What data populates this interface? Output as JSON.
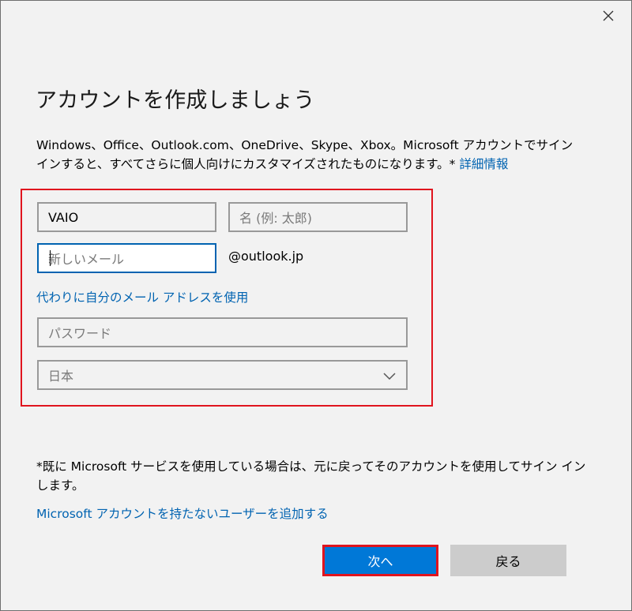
{
  "dialog": {
    "title": "アカウントを作成しましょう",
    "description_line1": "Windows、Office、Outlook.com、OneDrive、Skype、Xbox。Microsoft アカウントでサイン",
    "description_line2": "インすると、すべてさらに個人向けにカスタマイズされたものになります。*",
    "details_link": "詳細情報"
  },
  "form": {
    "last_name_value": "VAIO",
    "first_name_placeholder": "名 (例: 太郎)",
    "email_placeholder": "新しいメール",
    "email_domain": "@outlook.jp",
    "use_own_email_link": "代わりに自分のメール アドレスを使用",
    "password_placeholder": "パスワード",
    "country_selected": "日本"
  },
  "footer": {
    "note_line1": "*既に Microsoft サービスを使用している場合は、元に戻ってそのアカウントを使用してサイン イン",
    "note_line2": "します。",
    "add_user_link": "Microsoft アカウントを持たないユーザーを追加する",
    "next_label": "次へ",
    "back_label": "戻る"
  },
  "colors": {
    "accent": "#0078d7",
    "link": "#0063b1",
    "highlight": "#e0141e",
    "background": "#f2f2f2"
  },
  "icons": {
    "close": "close-icon",
    "dropdown": "chevron-down-icon"
  }
}
